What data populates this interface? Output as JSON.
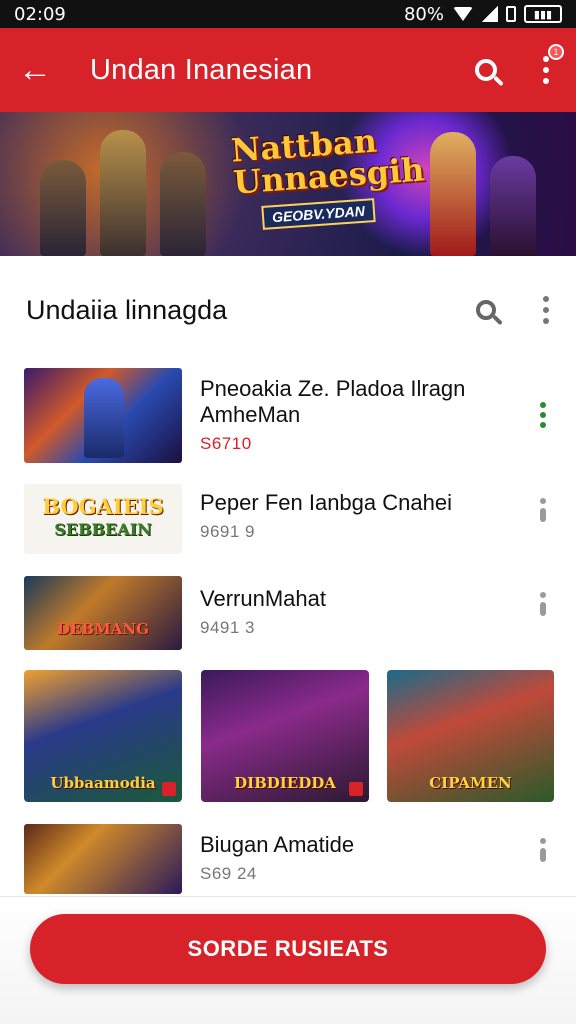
{
  "status_bar": {
    "time": "02:09",
    "battery_label": "80%",
    "battery_text": "▮▮▮"
  },
  "app_bar": {
    "title": "Undan Inanesian",
    "notification_count": "1"
  },
  "banner": {
    "title_line1": "Nattban",
    "title_line2": "Unnaesgih",
    "tag": "GEOBV.YDAN"
  },
  "section": {
    "title": "Undaiia linnagda"
  },
  "items": [
    {
      "title_line1": "Pneoakia Ze. Pladoa Ilragn",
      "title_line2": "AmheMan",
      "price": "S6710",
      "price_color": "#d62228",
      "thumb_text": ""
    },
    {
      "title_line1": "Peper Fen Ianbga Cnahei",
      "title_line2": "",
      "price": "9691 9",
      "thumb_text_1": "BOGAIEIS",
      "thumb_text_2": "SEBBEAIN"
    },
    {
      "title_line1": "VerrunMahat",
      "title_line2": "",
      "price": "9491 3",
      "thumb_text": "DEBMANG"
    },
    {
      "title_line1": "Biugan Amatide",
      "title_line2": "",
      "price": "S69 24",
      "thumb_text": ""
    }
  ],
  "grid": [
    {
      "label": "Ubbaamodia"
    },
    {
      "label": "DIBDIEDDA"
    },
    {
      "label": "CIPAMEN"
    }
  ],
  "primary_button": {
    "label": "SORDE RUSIEATS"
  },
  "colors": {
    "brand": "#d62228",
    "green_menu": "#2e8b2e"
  }
}
